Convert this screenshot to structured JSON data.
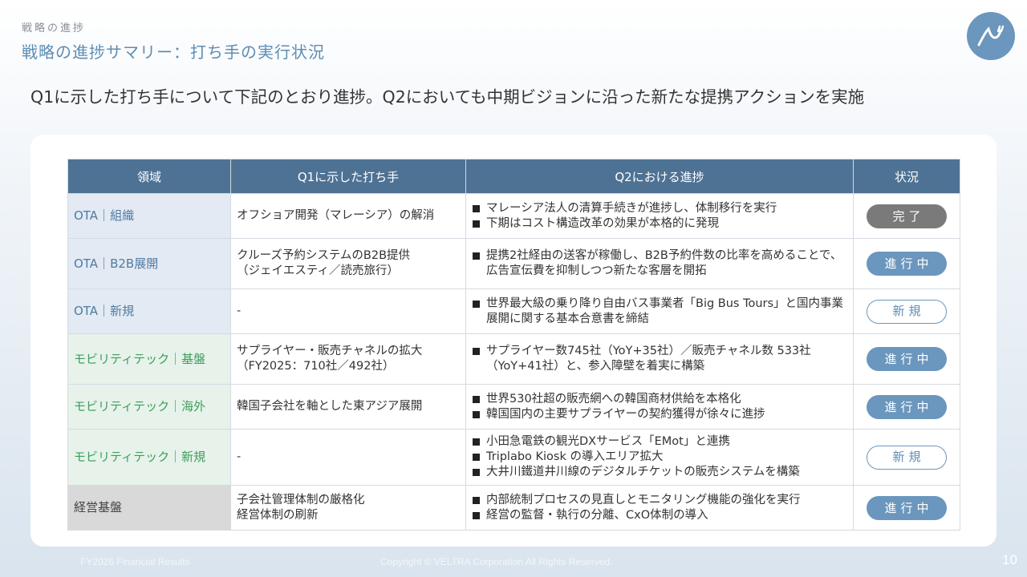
{
  "header": {
    "section": "戦略の進捗",
    "title": "戦略の進捗サマリー：打ち手の実行状況"
  },
  "logo": {
    "icon": "veltra-logo-icon",
    "color": "#6b96bd"
  },
  "headline": "Q1に示した打ち手について下記のとおり進捗。Q2においても中期ビジョンに沿った新たな提携アクションを実施",
  "table": {
    "headers": [
      "領域",
      "Q1に示した打ち手",
      "Q2における進捗",
      "状況"
    ],
    "rows": [
      {
        "area": "OTA｜組織",
        "q1_lines": [
          "オフショア開発（マレーシア）の解消"
        ],
        "progress": [
          "マレーシア法人の清算手続きが進捗し、体制移行を実行",
          "下期はコスト構造改革の効果が本格的に発現"
        ],
        "status": "完了"
      },
      {
        "area": "OTA｜B2B展開",
        "q1_lines": [
          "クルーズ予約システムのB2B提供",
          "（ジェイエスティ／読売旅行）"
        ],
        "progress": [
          "提携2社経由の送客が稼働し、B2B予約件数の比率を高めることで、広告宣伝費を抑制しつつ新たな客層を開拓"
        ],
        "status": "進行中"
      },
      {
        "area": "OTA｜新規",
        "q1_lines": [
          "-"
        ],
        "progress": [
          "世界最大級の乗り降り自由バス事業者「Big Bus Tours」と国内事業展開に関する基本合意書を締結"
        ],
        "status": "新規"
      },
      {
        "area": "モビリティテック｜基盤",
        "q1_lines": [
          "サプライヤー・販売チャネルの拡大",
          "（FY2025：710社／492社）"
        ],
        "progress": [
          "サプライヤー数745社（YoY+35社）／販売チャネル数 533社（YoY+41社）と、参入障壁を着実に構築"
        ],
        "status": "進行中"
      },
      {
        "area": "モビリティテック｜海外",
        "q1_lines": [
          "韓国子会社を軸とした東アジア展開"
        ],
        "progress": [
          "世界530社超の販売網への韓国商材供給を本格化",
          "韓国国内の主要サプライヤーの契約獲得が徐々に進捗"
        ],
        "status": "進行中"
      },
      {
        "area": "モビリティテック｜新規",
        "q1_lines": [
          "-"
        ],
        "progress": [
          "小田急電鉄の観光DXサービス「EMot」と連携",
          "Triplabo Kiosk の導入エリア拡大",
          "大井川鐵道井川線のデジタルチケットの販売システムを構築"
        ],
        "status": "新規"
      },
      {
        "area": "経営基盤",
        "q1_lines": [
          "子会社管理体制の厳格化",
          "経営体制の刷新"
        ],
        "progress": [
          "内部統制プロセスの見直しとモニタリング機能の強化を実行",
          "経営の監督・執行の分離、CxO体制の導入"
        ],
        "status": "進行中"
      }
    ]
  },
  "footer": {
    "left": "FY2026 Financial Results",
    "center": "Copyright © VELTRA Corporation All Rights Reserved.",
    "page": "10"
  }
}
